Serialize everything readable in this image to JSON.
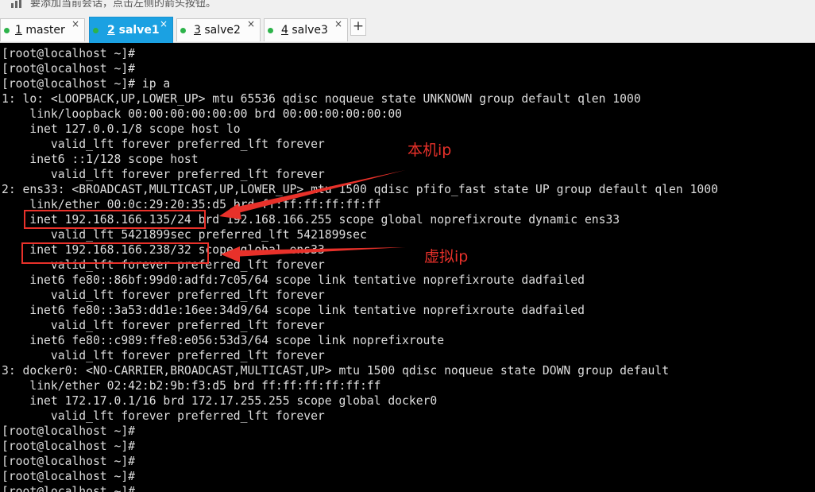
{
  "hint_bar": {
    "text": "要添加当前会话，点击左侧的箭头按钮。"
  },
  "tabs": [
    {
      "num": "1",
      "name": "master",
      "close": "×"
    },
    {
      "num": "2",
      "name": "salve1",
      "close": "×"
    },
    {
      "num": "3",
      "name": "salve2",
      "close": "×"
    },
    {
      "num": "4",
      "name": "salve3",
      "close": "×"
    }
  ],
  "active_tab": "2 salve1",
  "new_tab_label": "+",
  "colors": {
    "active_tab": "#1ba1e2",
    "status_dot": "#2db34a",
    "annotation": "#e8312a",
    "terminal_bg": "#000000",
    "terminal_fg": "#dedede"
  },
  "icons": {
    "hint": "bars-icon",
    "new_tab": "plus-icon"
  },
  "terminal": {
    "lines": [
      "[root@localhost ~]#",
      "[root@localhost ~]#",
      "[root@localhost ~]# ip a",
      "1: lo: <LOOPBACK,UP,LOWER_UP> mtu 65536 qdisc noqueue state UNKNOWN group default qlen 1000",
      "    link/loopback 00:00:00:00:00:00 brd 00:00:00:00:00:00",
      "    inet 127.0.0.1/8 scope host lo",
      "       valid_lft forever preferred_lft forever",
      "    inet6 ::1/128 scope host",
      "       valid_lft forever preferred_lft forever",
      "2: ens33: <BROADCAST,MULTICAST,UP,LOWER_UP> mtu 1500 qdisc pfifo_fast state UP group default qlen 1000",
      "    link/ether 00:0c:29:20:35:d5 brd ff:ff:ff:ff:ff:ff",
      "    inet 192.168.166.135/24 brd 192.168.166.255 scope global noprefixroute dynamic ens33",
      "       valid_lft 5421899sec preferred_lft 5421899sec",
      "    inet 192.168.166.238/32 scope global ens33",
      "       valid_lft forever preferred_lft forever",
      "    inet6 fe80::86bf:99d0:adfd:7c05/64 scope link tentative noprefixroute dadfailed",
      "       valid_lft forever preferred_lft forever",
      "    inet6 fe80::3a53:dd1e:16ee:34d9/64 scope link tentative noprefixroute dadfailed",
      "       valid_lft forever preferred_lft forever",
      "    inet6 fe80::c989:ffe8:e056:53d3/64 scope link noprefixroute",
      "       valid_lft forever preferred_lft forever",
      "3: docker0: <NO-CARRIER,BROADCAST,MULTICAST,UP> mtu 1500 qdisc noqueue state DOWN group default",
      "    link/ether 02:42:b2:9b:f3:d5 brd ff:ff:ff:ff:ff:ff",
      "    inet 172.17.0.1/16 brd 172.17.255.255 scope global docker0",
      "       valid_lft forever preferred_lft forever",
      "[root@localhost ~]#",
      "[root@localhost ~]#",
      "[root@localhost ~]#",
      "[root@localhost ~]#",
      "[root@localhost ~]#"
    ]
  },
  "annotations": {
    "local_ip_label": "本机ip",
    "virtual_ip_label": "虚拟ip"
  }
}
